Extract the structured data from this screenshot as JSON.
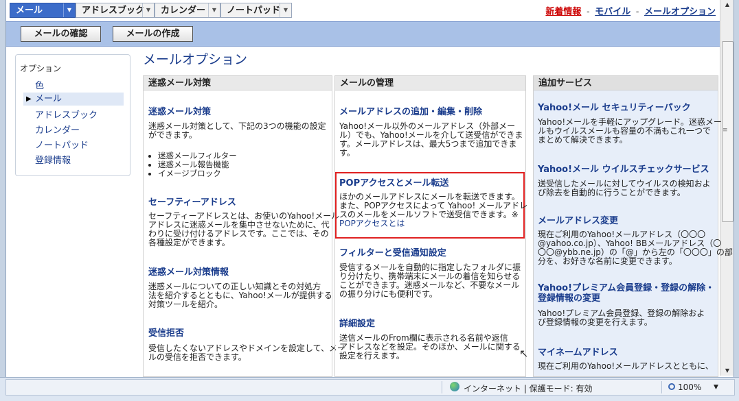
{
  "nav": {
    "tabs": [
      {
        "label": "メール"
      },
      {
        "label": "アドレスブック"
      },
      {
        "label": "カレンダー"
      },
      {
        "label": "ノートパッド"
      }
    ],
    "links": {
      "new": "新着情報",
      "mobile": "モバイル",
      "options": "メールオプション",
      "sep": "-"
    }
  },
  "toolbar": {
    "check_label": "メールの確認",
    "compose_label": "メールの作成"
  },
  "sidebar": {
    "title": "オプション",
    "items": [
      {
        "label": "色"
      },
      {
        "label": "メール"
      },
      {
        "label": "アドレスブック"
      },
      {
        "label": "カレンダー"
      },
      {
        "label": "ノートパッド"
      },
      {
        "label": "登録情報"
      }
    ]
  },
  "page": {
    "title": "メールオプション"
  },
  "col1": {
    "header": "迷惑メール対策",
    "s1_title": "迷惑メール対策",
    "s1_desc_l1": "迷惑メール対策として、下記の3つの機能の設定",
    "s1_desc_l2": "ができます。",
    "s1_bullets": [
      "迷惑メールフィルター",
      "迷惑メール報告機能",
      "イメージブロック"
    ],
    "s2_title": "セーフティーアドレス",
    "s2_desc_l1": "セーフティーアドレスとは、お使いのYahoo!メール",
    "s2_desc_l2": "アドレスに迷惑メールを集中させないために、代",
    "s2_desc_l3": "わりに受け付けるアドレスです。ここでは、その",
    "s2_desc_l4": "各種設定ができます。",
    "s3_title": "迷惑メール対策情報",
    "s3_desc_l1": "迷惑メールについての正しい知識とその対処方",
    "s3_desc_l2": "法を紹介するとともに、Yahoo!メールが提供する",
    "s3_desc_l3": "対策ツールを紹介。",
    "s4_title": "受信拒否",
    "s4_desc_l1": "受信したくないアドレスやドメインを設定して、メー",
    "s4_desc_l2": "ルの受信を拒否できます。"
  },
  "col2": {
    "header": "メールの管理",
    "s1_title": "メールアドレスの追加・編集・削除",
    "s1_desc_l1": "Yahoo!メール以外のメールアドレス（外部メー",
    "s1_desc_l2": "ル）でも、Yahoo!メールを介して送受信ができま",
    "s1_desc_l3": "す。メールアドレスは、最大5つまで追加できま",
    "s1_desc_l4": "す。",
    "s2_title": "POPアクセスとメール転送",
    "s2_desc_l1": "ほかのメールアドレスにメールを転送できます。",
    "s2_desc_l2": "また、POPアクセスによって Yahoo! メールアドレ",
    "s2_desc_l3": "スのメールをメールソフトで送受信できます。※",
    "s2_link": "POPアクセスとは",
    "s3_title": "フィルターと受信通知設定",
    "s3_desc_l1": "受信するメールを自動的に指定したフォルダに振",
    "s3_desc_l2": "り分けたり、携帯端末にメールの着信を知らせる",
    "s3_desc_l3": "ことができます。迷惑メールなど、不要なメール",
    "s3_desc_l4": "の振り分けにも便利です。",
    "s4_title": "詳細設定",
    "s4_desc_l1": "送信メールのFrom欄に表示される名前や返信",
    "s4_desc_l2": "アドレスなどを設定。そのほか、メールに関する",
    "s4_desc_l3": "設定を行えます。"
  },
  "col3": {
    "header": "追加サービス",
    "s1_title": "Yahoo!メール セキュリティーパック",
    "s1_desc_l1": "Yahoo!メールを手軽にアップグレード。迷惑メー",
    "s1_desc_l2": "ルもウイルスメールも容量の不満もこれ一つで",
    "s1_desc_l3": "まとめて解決できます。",
    "s2_title": "Yahoo!メール ウイルスチェックサービス",
    "s2_desc_l1": "送受信したメールに対してウイルスの検知およ",
    "s2_desc_l2": "び除去を自動的に行うことができます。",
    "s3_title": "メールアドレス変更",
    "s3_desc_l1": "現在ご利用のYahoo!メールアドレス（〇〇〇",
    "s3_desc_l2": "@yahoo.co.jp）、Yahoo! BBメールアドレス（〇",
    "s3_desc_l3": "〇〇@ybb.ne.jp）の「@」から左の「〇〇〇」の部",
    "s3_desc_l4": "分を、お好きな名前に変更できます。",
    "s4_title_l1": "Yahoo!プレミアム会員登録・登録の解除・",
    "s4_title_l2": "登録情報の変更",
    "s4_desc_l1": "Yahoo!プレミアム会員登録、登録の解除およ",
    "s4_desc_l2": "び登録情報の変更を行えます。",
    "s5_title": "マイネームアドレス",
    "s5_desc_l1": "現在ご利用のYahoo!メールアドレスとともに、"
  },
  "status": {
    "zone": "インターネット | 保護モード: 有効",
    "zoom": "100%"
  }
}
